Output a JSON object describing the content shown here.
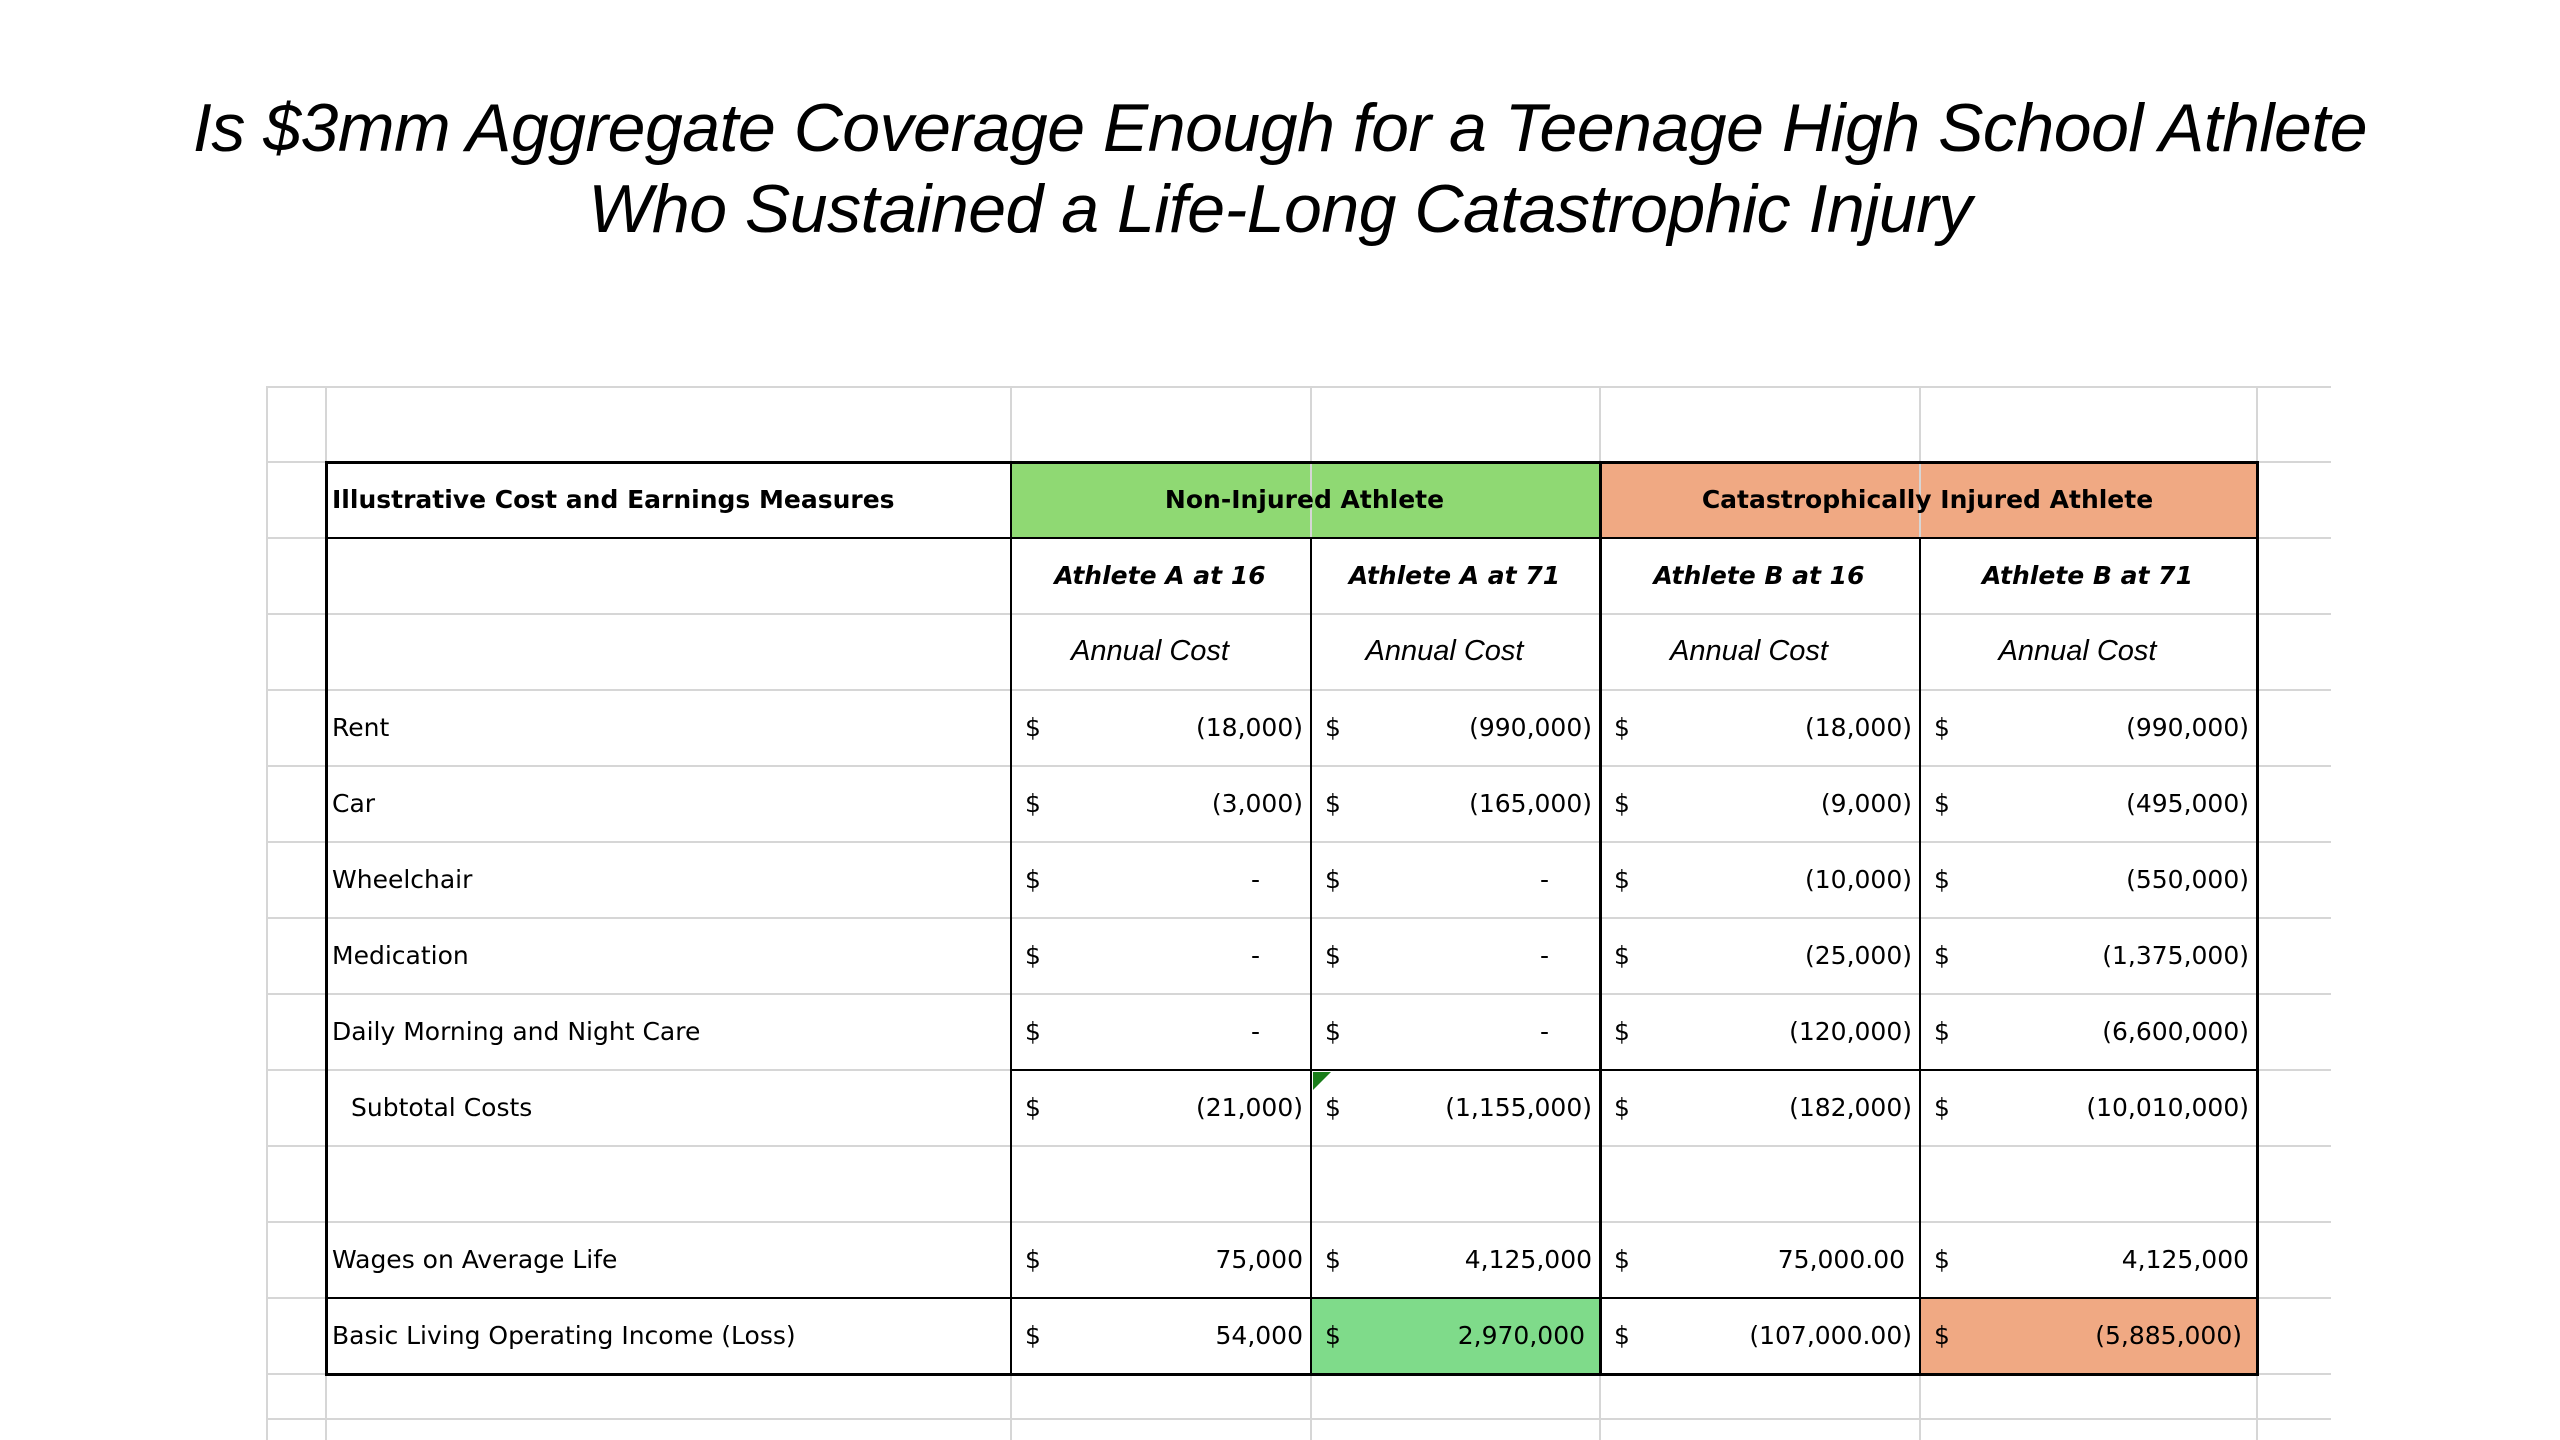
{
  "title": {
    "line1": "Is $3mm Aggregate Coverage Enough for a Teenage High School Athlete",
    "line2": "Who Sustained a Life-Long Catastrophic Injury"
  },
  "colors": {
    "non_injured_fill": "#8fd973",
    "injured_fill": "#f0a983",
    "highlight_green": "#7fdb8a",
    "highlight_orange": "#f0a983",
    "gridline": "#d6d6d6",
    "border": "#000000"
  },
  "table": {
    "header_label": "Illustrative Cost and Earnings Measures",
    "group_non_injured": "Non-Injured Athlete",
    "group_injured": "Catastrophically Injured Athlete",
    "subheaders": [
      "Athlete A at 16",
      "Athlete A at 71",
      "Athlete B at 16",
      "Athlete B at 71"
    ],
    "annual_cost": [
      "Annual Cost",
      "Annual Cost",
      "Annual Cost",
      "Annual Cost"
    ],
    "currency": "$",
    "rows": [
      {
        "label": "Rent",
        "values": [
          "(18,000)",
          "(990,000)",
          "(18,000)",
          "(990,000)"
        ]
      },
      {
        "label": "Car",
        "values": [
          "(3,000)",
          "(165,000)",
          "(9,000)",
          "(495,000)"
        ]
      },
      {
        "label": "Wheelchair",
        "values": [
          "-",
          "-",
          "(10,000)",
          "(550,000)"
        ]
      },
      {
        "label": "Medication",
        "values": [
          "-",
          "-",
          "(25,000)",
          "(1,375,000)"
        ]
      },
      {
        "label": "Daily Morning and Night Care",
        "values": [
          "-",
          "-",
          "(120,000)",
          "(6,600,000)"
        ]
      },
      {
        "label": "Subtotal Costs",
        "values": [
          "(21,000)",
          "(1,155,000)",
          "(182,000)",
          "(10,010,000)"
        ]
      },
      {
        "label": "",
        "values": [
          "",
          "",
          "",
          ""
        ]
      },
      {
        "label": "Wages on Average Life",
        "values": [
          "75,000",
          "4,125,000",
          "75,000.00",
          "4,125,000"
        ]
      },
      {
        "label": "Basic Living Operating Income (Loss)",
        "values": [
          "54,000",
          "2,970,000",
          "(107,000.00)",
          "(5,885,000)"
        ]
      }
    ]
  }
}
